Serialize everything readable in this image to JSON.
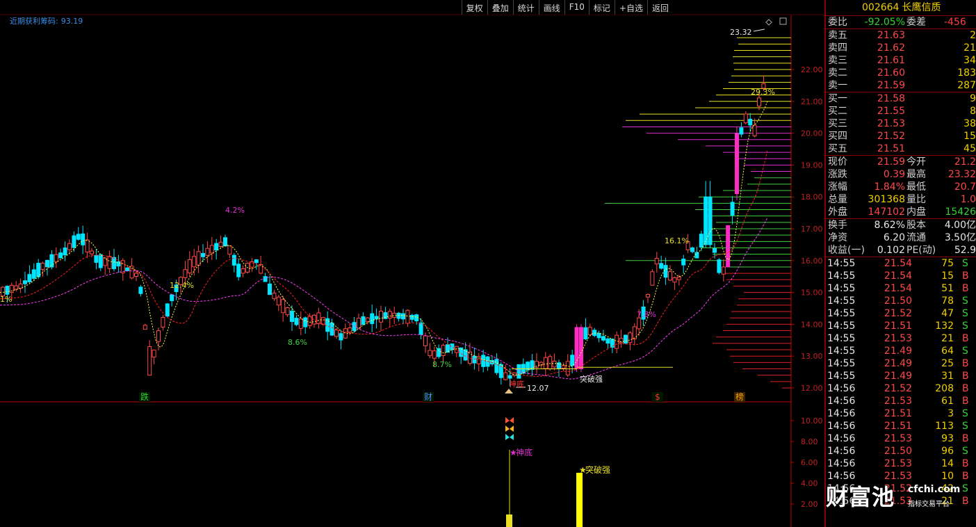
{
  "toolbar": [
    "复权",
    "叠加",
    "统计",
    "画线",
    "F10",
    "标记",
    "+自选",
    "返回"
  ],
  "indicator_title": {
    "name": "近期获利筹码:",
    "value": "93.19"
  },
  "main_axis": [
    "22.00",
    "21.00",
    "20.00",
    "19.00",
    "18.00",
    "17.00",
    "16.00",
    "15.00",
    "14.00",
    "13.00",
    "12.00"
  ],
  "sub_axis": [
    "10.00",
    "8.00",
    "6.00",
    "4.00",
    "2.00"
  ],
  "annotations": {
    "left_pct": "1%",
    "pct_42": "4.2%",
    "pct_124": "12.4%",
    "pct_86": "8.6%",
    "pct_87": "8.7%",
    "pct_161": "16.1%",
    "pct_78": "7.8%",
    "pct_293": "29.3%",
    "high_label": "23.32",
    "low_label": "12.07",
    "breakout_label": "突破强",
    "bottom_label": "神底"
  },
  "events": [
    {
      "text": "跌",
      "color": "#34d234"
    },
    {
      "text": "财",
      "color": "#4f8cff"
    },
    {
      "text": "$",
      "color": "#ff3030"
    },
    {
      "text": "榜",
      "color": "#f2a000"
    }
  ],
  "sub_labels": {
    "bottom": "神底",
    "breakout": "突破强"
  },
  "sub_values": {
    "bottom_bar": 1.0,
    "breakout_bar": 5.0
  },
  "stock": {
    "code": "002664",
    "name": "长鹰信质"
  },
  "order_book": {
    "weibi": {
      "label": "委比",
      "value": "-92.05%",
      "label2": "委差",
      "value2": "-456"
    },
    "asks": [
      {
        "label": "卖五",
        "price": "21.63",
        "vol": "2"
      },
      {
        "label": "卖四",
        "price": "21.62",
        "vol": "21"
      },
      {
        "label": "卖三",
        "price": "21.61",
        "vol": "34"
      },
      {
        "label": "卖二",
        "price": "21.60",
        "vol": "183"
      },
      {
        "label": "卖一",
        "price": "21.59",
        "vol": "287"
      }
    ],
    "bids": [
      {
        "label": "买一",
        "price": "21.58",
        "vol": "9"
      },
      {
        "label": "买二",
        "price": "21.55",
        "vol": "8"
      },
      {
        "label": "买三",
        "price": "21.53",
        "vol": "38"
      },
      {
        "label": "买四",
        "price": "21.52",
        "vol": "15"
      },
      {
        "label": "买五",
        "price": "21.51",
        "vol": "45"
      }
    ]
  },
  "quote": [
    {
      "l1": "现价",
      "v1": "21.59",
      "c1": "red",
      "l2": "今开",
      "v2": "21.2"
    },
    {
      "l1": "涨跌",
      "v1": "0.39",
      "c1": "red",
      "l2": "最高",
      "v2": "23.32"
    },
    {
      "l1": "涨幅",
      "v1": "1.84%",
      "c1": "red",
      "l2": "最低",
      "v2": "20.7"
    },
    {
      "l1": "总量",
      "v1": "301368",
      "c1": "yel",
      "l2": "量比",
      "v2": "1.0"
    },
    {
      "l1": "外盘",
      "v1": "147102",
      "c1": "red",
      "l2": "内盘",
      "v2": "15426"
    }
  ],
  "fundamentals": [
    {
      "l1": "换手",
      "v1": "8.62%",
      "l2": "股本",
      "v2": "4.00亿"
    },
    {
      "l1": "净资",
      "v1": "6.20",
      "l2": "流通",
      "v2": "3.50亿"
    },
    {
      "l1": "收益(一)",
      "v1": "0.102",
      "l2": "PE(动)",
      "v2": "52.9"
    }
  ],
  "ticks": [
    {
      "t": "14:55",
      "p": "21.54",
      "c": "red",
      "v": "75",
      "bs": "S"
    },
    {
      "t": "14:55",
      "p": "21.54",
      "c": "red",
      "v": "15",
      "bs": "B"
    },
    {
      "t": "14:55",
      "p": "21.54",
      "c": "red",
      "v": "51",
      "bs": "B"
    },
    {
      "t": "14:55",
      "p": "21.50",
      "c": "red",
      "v": "78",
      "bs": "S"
    },
    {
      "t": "14:55",
      "p": "21.52",
      "c": "red",
      "v": "47",
      "bs": "S"
    },
    {
      "t": "14:55",
      "p": "21.51",
      "c": "red",
      "v": "132",
      "bs": "S"
    },
    {
      "t": "14:55",
      "p": "21.53",
      "c": "red",
      "v": "21",
      "bs": "B"
    },
    {
      "t": "14:55",
      "p": "21.49",
      "c": "red",
      "v": "64",
      "bs": "S"
    },
    {
      "t": "14:55",
      "p": "21.49",
      "c": "red",
      "v": "25",
      "bs": "B"
    },
    {
      "t": "14:55",
      "p": "21.49",
      "c": "red",
      "v": "31",
      "bs": "B"
    },
    {
      "t": "14:56",
      "p": "21.52",
      "c": "red",
      "v": "208",
      "bs": "B"
    },
    {
      "t": "14:56",
      "p": "21.53",
      "c": "red",
      "v": "61",
      "bs": "B"
    },
    {
      "t": "14:56",
      "p": "21.51",
      "c": "red",
      "v": "3",
      "bs": "S"
    },
    {
      "t": "14:56",
      "p": "21.51",
      "c": "red",
      "v": "113",
      "bs": "S"
    },
    {
      "t": "14:56",
      "p": "21.53",
      "c": "red",
      "v": "93",
      "bs": "B"
    },
    {
      "t": "14:56",
      "p": "21.50",
      "c": "red",
      "v": "96",
      "bs": "S"
    },
    {
      "t": "14:56",
      "p": "21.53",
      "c": "red",
      "v": "14",
      "bs": "B"
    },
    {
      "t": "14:56",
      "p": "21.53",
      "c": "red",
      "v": "10",
      "bs": "B"
    },
    {
      "t": "14:56",
      "p": "21.52",
      "c": "red",
      "v": "42",
      "bs": "S"
    },
    {
      "t": "14:56",
      "p": "21.53",
      "c": "red",
      "v": "21",
      "bs": "B"
    }
  ],
  "watermark": {
    "big": "财富池",
    "url": "cfchi.com",
    "sub": "指标交易平台"
  },
  "colors": {
    "up": "#ff4848",
    "down": "#00e5ff",
    "axis": "#c00000",
    "ma1": "#ffff40",
    "ma2": "#ff2020",
    "ma3": "#ff40ff",
    "magenta": "#ff2cc4",
    "chip_yellow": "#e8e020",
    "chip_magenta": "#e030d0",
    "chip_green": "#40d040",
    "chip_red": "#e02020"
  }
}
